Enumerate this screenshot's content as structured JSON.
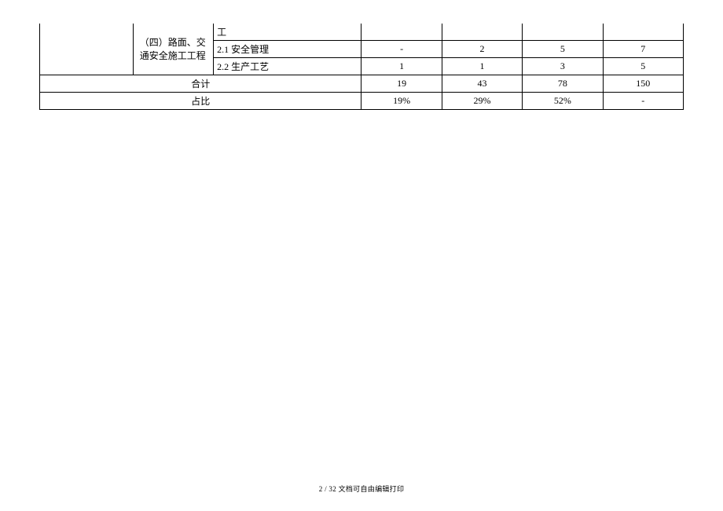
{
  "rows": {
    "r0": {
      "c_text": "工"
    },
    "r1": {
      "rowLabel": "（四）路面、交通安全施工工程",
      "c_text": "2.1 安全管理",
      "d": "-",
      "e": "2",
      "f": "5",
      "g": "7"
    },
    "r2": {
      "c_text": "2.2 生产工艺",
      "d": "1",
      "e": "1",
      "f": "3",
      "g": "5"
    },
    "total": {
      "label": "合计",
      "d": "19",
      "e": "43",
      "f": "78",
      "g": "150"
    },
    "ratio": {
      "label": "占比",
      "d": "19%",
      "e": "29%",
      "f": "52%",
      "g": "-"
    }
  },
  "footer": "2 / 32 文档可自由编辑打印"
}
